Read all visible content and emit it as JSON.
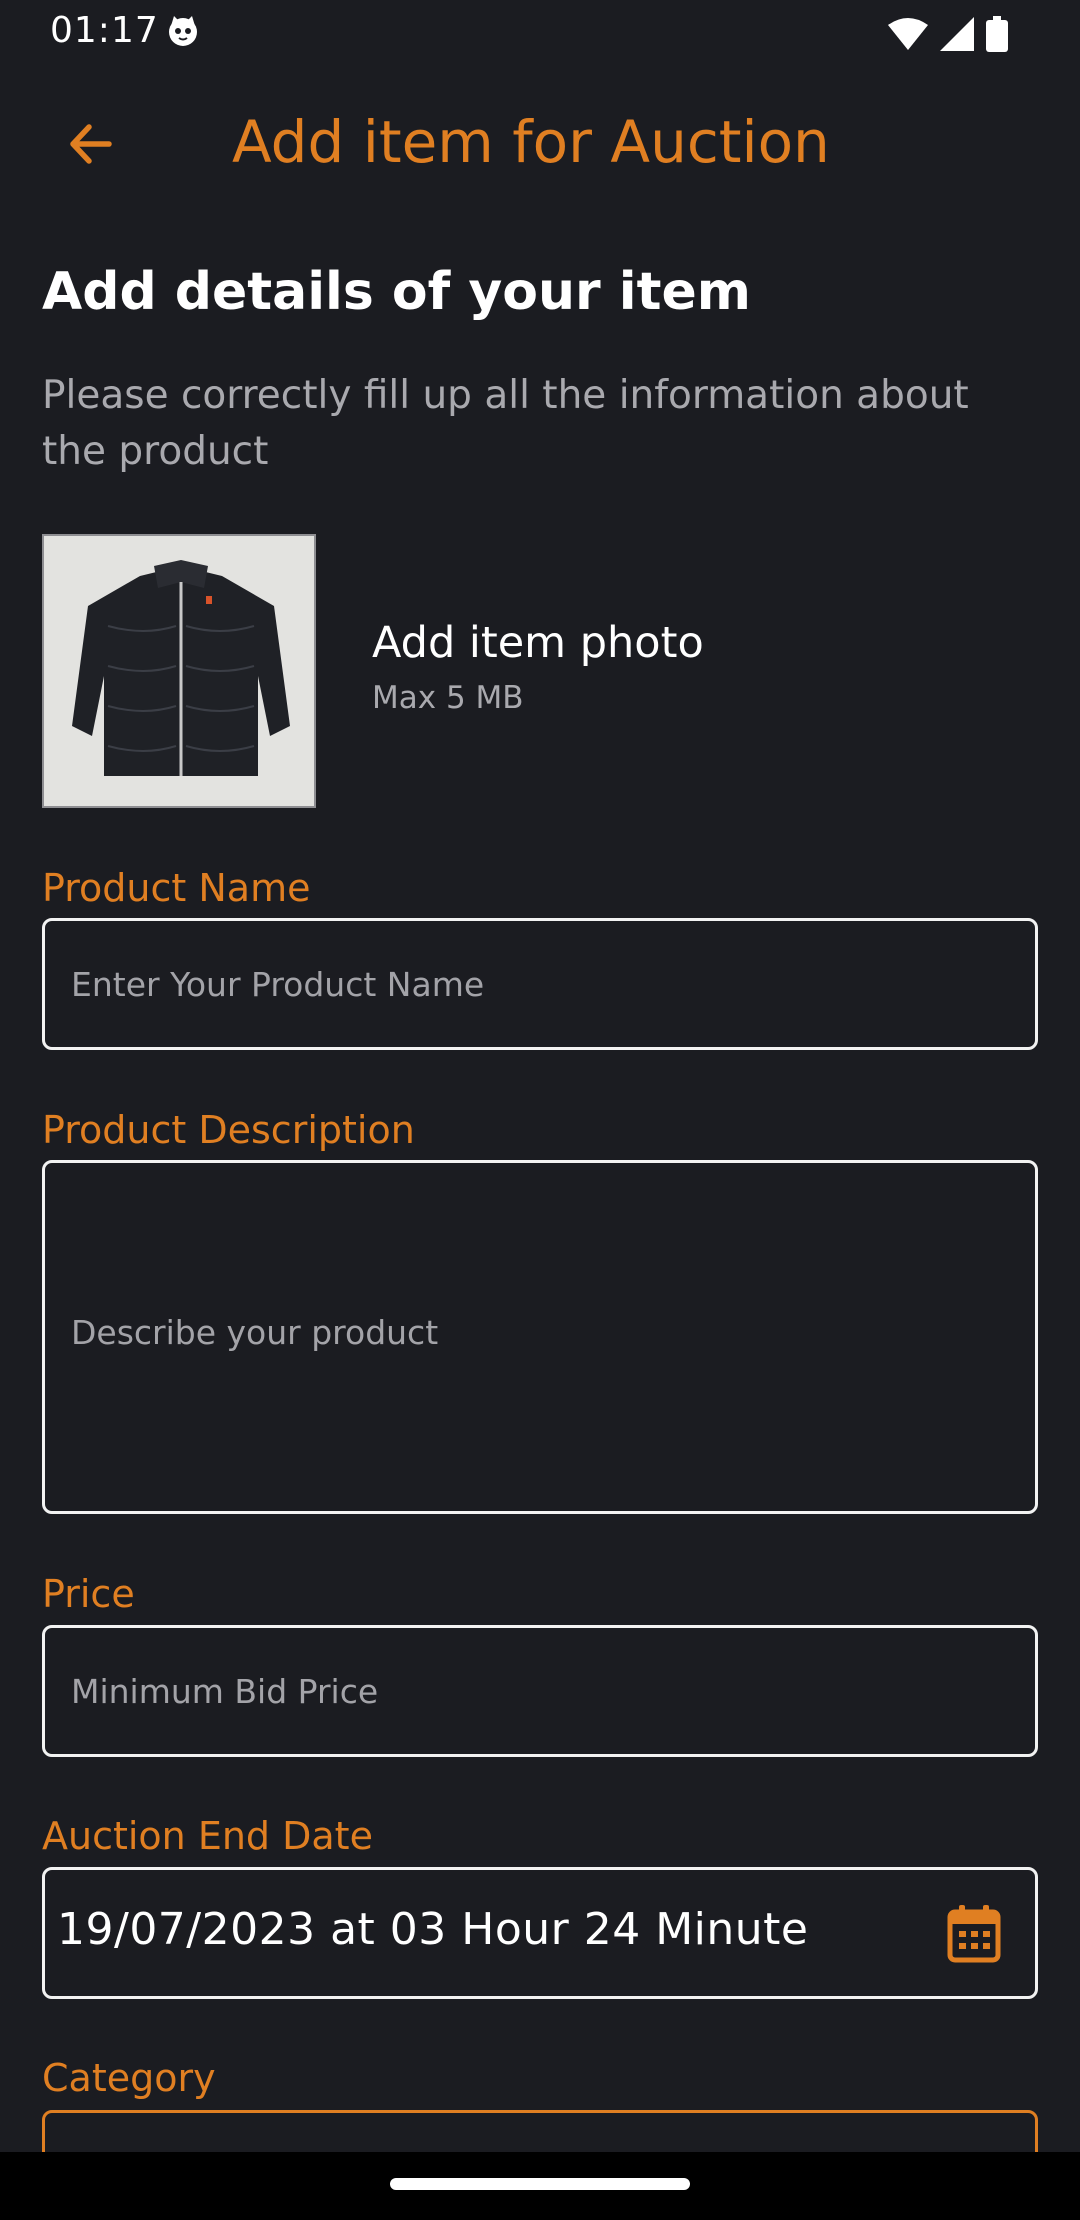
{
  "status_bar": {
    "time": "01:17",
    "icons": [
      "cat-face-icon",
      "wifi-icon",
      "signal-icon",
      "battery-icon"
    ]
  },
  "app_bar": {
    "back_icon": "arrow-left-icon",
    "title": "Add item for Auction"
  },
  "intro": {
    "title": "Add details of your item",
    "subtitle": "Please correctly fill up all the information about the product"
  },
  "photo": {
    "label": "Add item photo",
    "hint": "Max 5 MB"
  },
  "form": {
    "product_name": {
      "label": "Product Name",
      "placeholder": "Enter Your Product Name",
      "value": ""
    },
    "product_description": {
      "label": "Product Description",
      "placeholder": "Describe your product",
      "value": ""
    },
    "price": {
      "label": "Price",
      "placeholder": "Minimum Bid Price",
      "value": ""
    },
    "auction_end_date": {
      "label": "Auction End Date",
      "value": "19/07/2023 at 03 Hour 24 Minute",
      "icon": "calendar-icon"
    },
    "category": {
      "label": "Category"
    }
  },
  "colors": {
    "background": "#1b1c21",
    "accent": "#e07f22",
    "text": "#ffffff",
    "muted": "#a9a9ae",
    "field_border": "#f2f2f2"
  }
}
